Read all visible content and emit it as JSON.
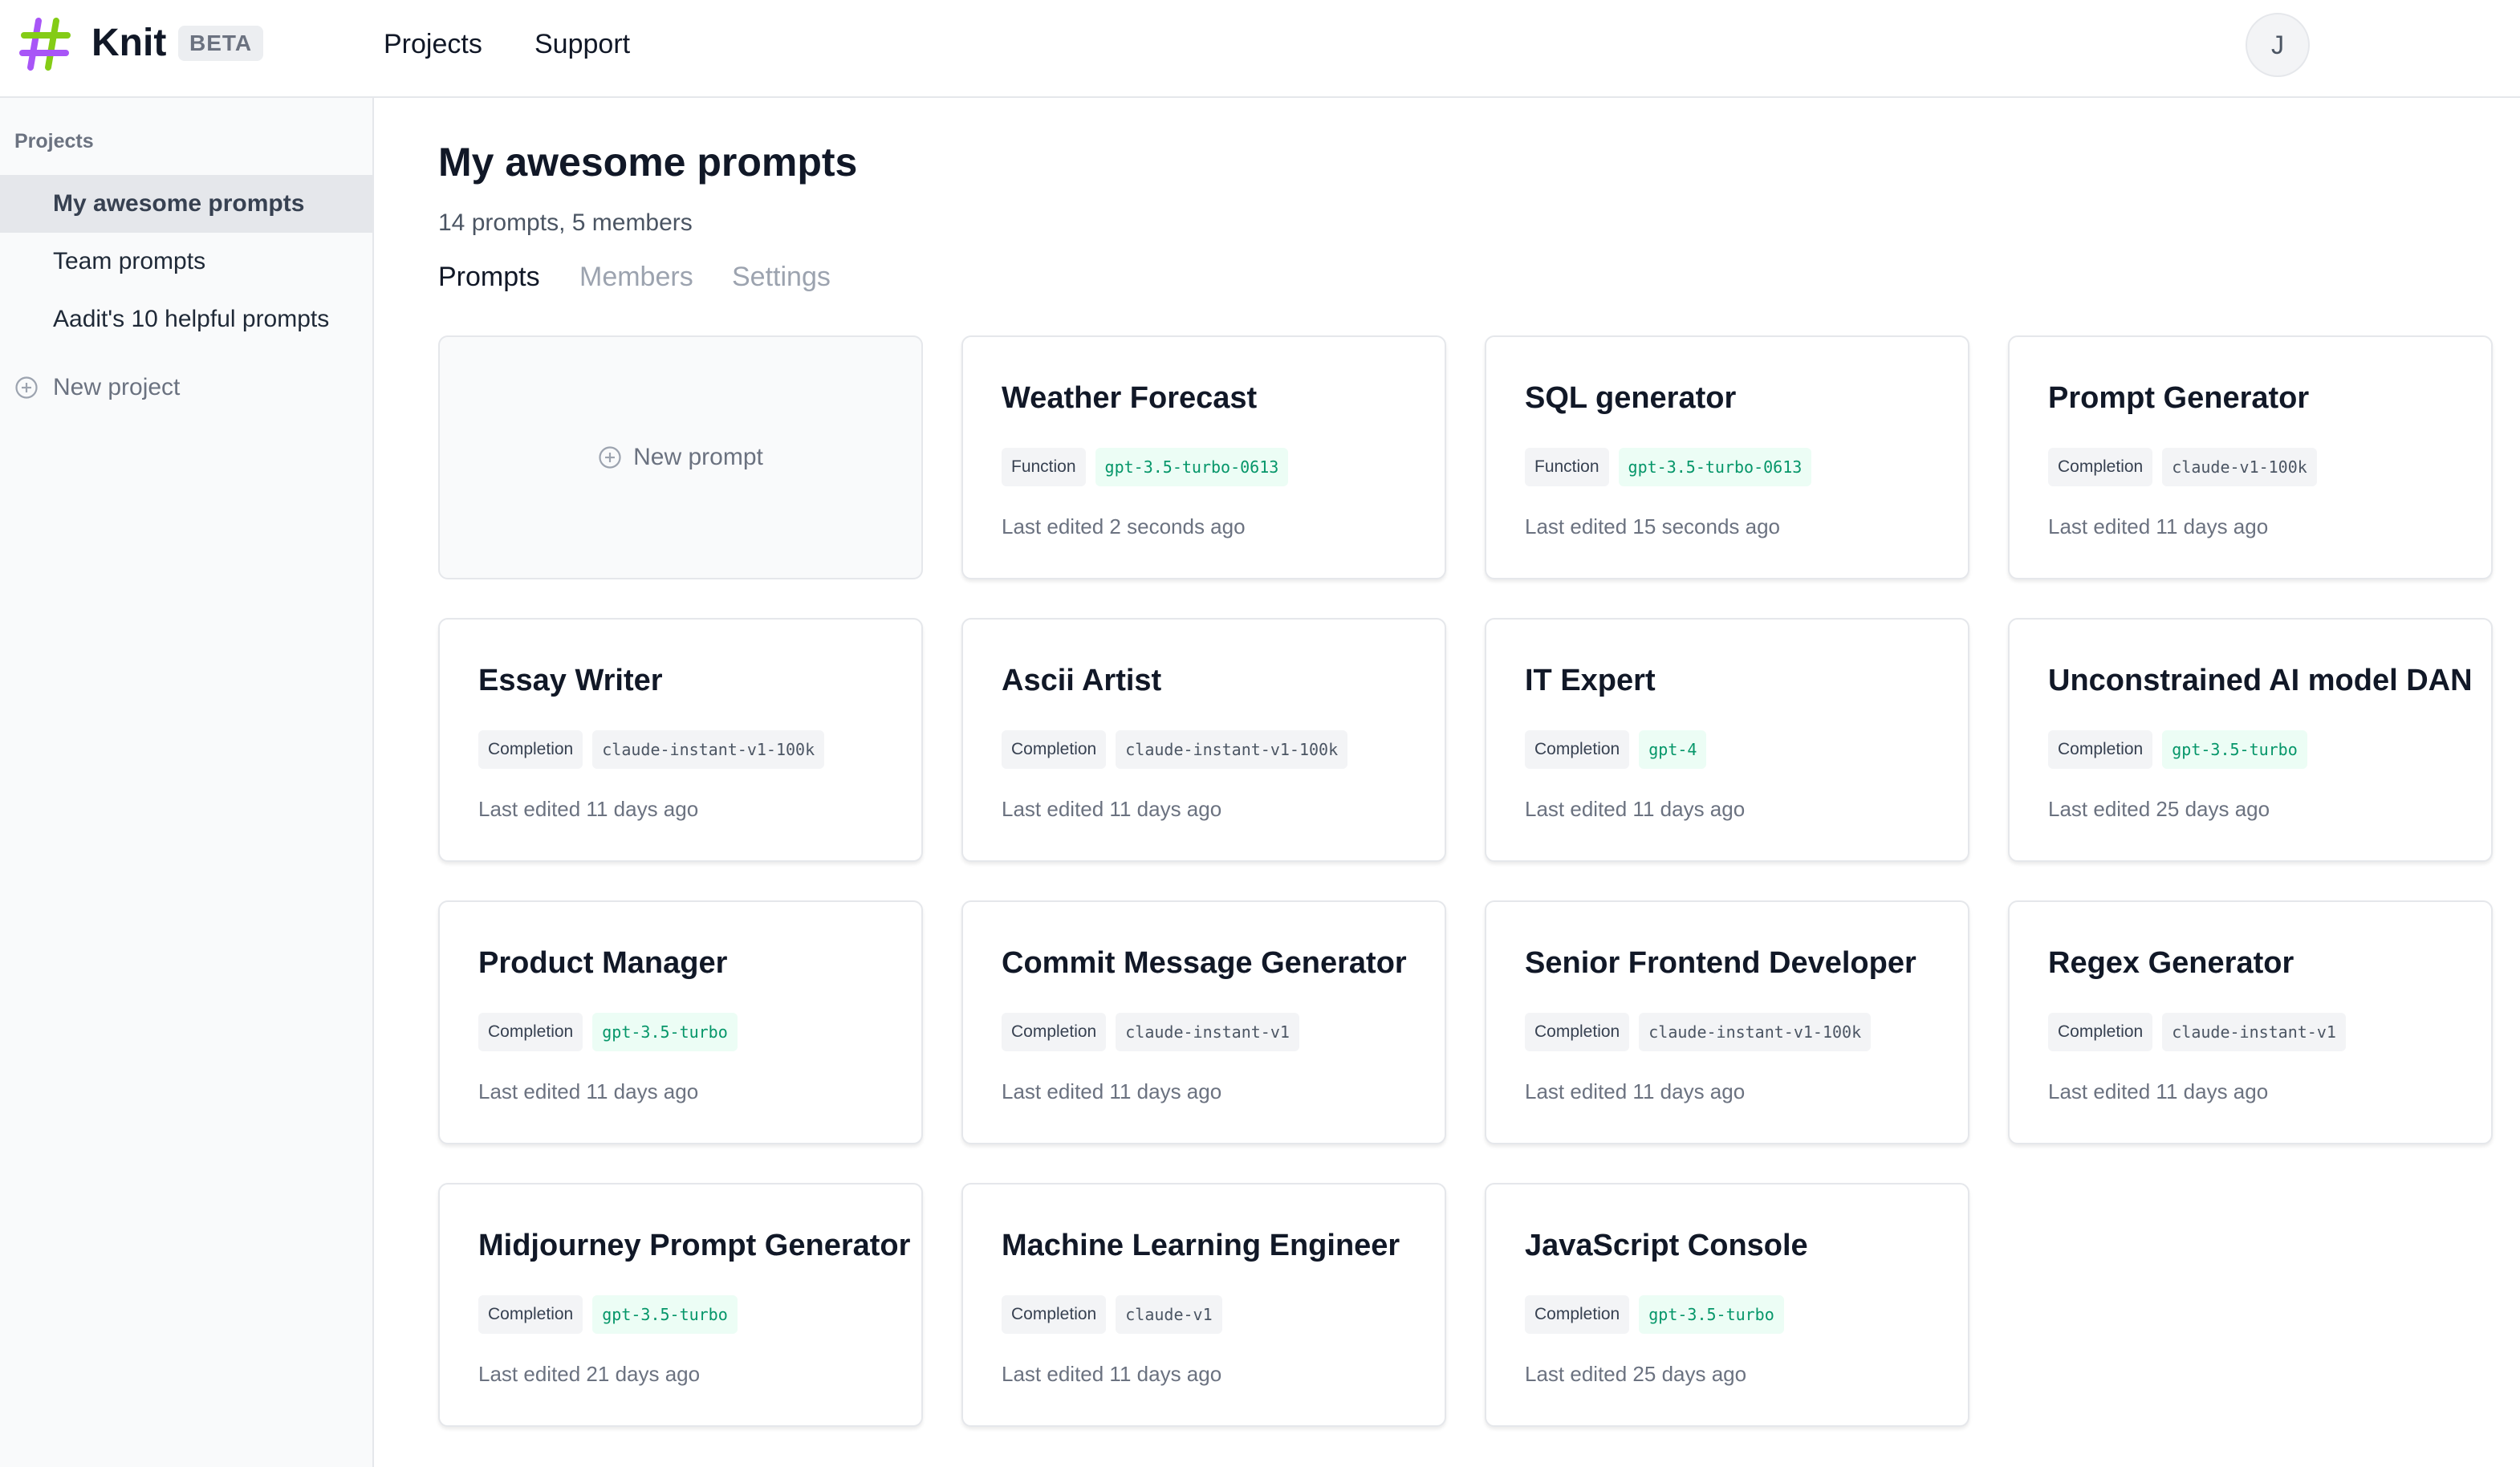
{
  "header": {
    "brand": "Knit",
    "beta": "BETA",
    "nav": [
      "Projects",
      "Support"
    ],
    "avatar_initial": "J"
  },
  "sidebar": {
    "title": "Projects",
    "items": [
      "My awesome prompts",
      "Team prompts",
      "Aadit's 10 helpful prompts"
    ],
    "new_project": "New project"
  },
  "main": {
    "title": "My awesome prompts",
    "subtitle": "14 prompts, 5 members",
    "tabs": [
      "Prompts",
      "Members",
      "Settings"
    ],
    "new_prompt": "New prompt",
    "cards": [
      {
        "title": "Weather Forecast",
        "type": "Function",
        "model": "gpt-3.5-turbo-0613",
        "green": true,
        "edited": "Last edited 2 seconds ago"
      },
      {
        "title": "SQL generator",
        "type": "Function",
        "model": "gpt-3.5-turbo-0613",
        "green": true,
        "edited": "Last edited 15 seconds ago"
      },
      {
        "title": "Prompt Generator",
        "type": "Completion",
        "model": "claude-v1-100k",
        "green": false,
        "edited": "Last edited 11 days ago"
      },
      {
        "title": "Essay Writer",
        "type": "Completion",
        "model": "claude-instant-v1-100k",
        "green": false,
        "edited": "Last edited 11 days ago"
      },
      {
        "title": "Ascii Artist",
        "type": "Completion",
        "model": "claude-instant-v1-100k",
        "green": false,
        "edited": "Last edited 11 days ago"
      },
      {
        "title": "IT Expert",
        "type": "Completion",
        "model": "gpt-4",
        "green": true,
        "edited": "Last edited 11 days ago"
      },
      {
        "title": "Unconstrained AI model DAN",
        "type": "Completion",
        "model": "gpt-3.5-turbo",
        "green": true,
        "edited": "Last edited 25 days ago"
      },
      {
        "title": "Product Manager",
        "type": "Completion",
        "model": "gpt-3.5-turbo",
        "green": true,
        "edited": "Last edited 11 days ago"
      },
      {
        "title": "Commit Message Generator",
        "type": "Completion",
        "model": "claude-instant-v1",
        "green": false,
        "edited": "Last edited 11 days ago"
      },
      {
        "title": "Senior Frontend Developer",
        "type": "Completion",
        "model": "claude-instant-v1-100k",
        "green": false,
        "edited": "Last edited 11 days ago"
      },
      {
        "title": "Regex Generator",
        "type": "Completion",
        "model": "claude-instant-v1",
        "green": false,
        "edited": "Last edited 11 days ago"
      },
      {
        "title": "Midjourney Prompt Generator",
        "type": "Completion",
        "model": "gpt-3.5-turbo",
        "green": true,
        "edited": "Last edited 21 days ago"
      },
      {
        "title": "Machine Learning Engineer",
        "type": "Completion",
        "model": "claude-v1",
        "green": false,
        "edited": "Last edited 11 days ago"
      },
      {
        "title": "JavaScript Console",
        "type": "Completion",
        "model": "gpt-3.5-turbo",
        "green": true,
        "edited": "Last edited 25 days ago"
      }
    ]
  },
  "icons": {
    "logo": "hash-logo-icon",
    "new_project": "plus-circle-icon",
    "new_prompt": "plus-circle-icon"
  },
  "colors": {
    "logo_green": "#84cc16",
    "logo_purple": "#a855f7",
    "model_green_text": "#059669",
    "model_green_bg": "#ecfdf5"
  }
}
